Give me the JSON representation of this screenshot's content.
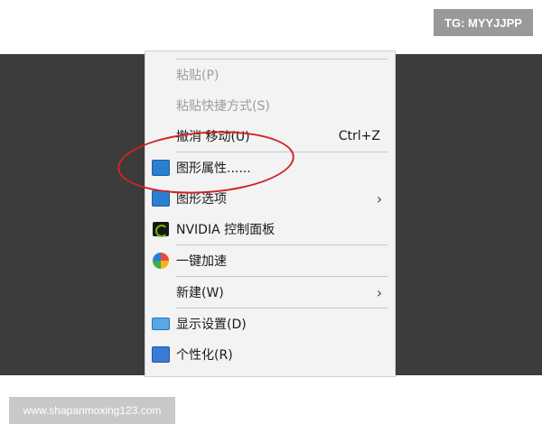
{
  "watermark_top": "TG: MYYJJPP",
  "watermark_bottom": "www.shapanmoxing123.com",
  "menu": {
    "paste": "粘贴(P)",
    "paste_shortcut": "粘贴快捷方式(S)",
    "undo": "撤消 移动(U)",
    "undo_key": "Ctrl+Z",
    "graphics_properties": "图形属性......",
    "graphics_options": "图形选项",
    "nvidia_panel": "NVIDIA 控制面板",
    "one_key_speed": "一键加速",
    "new": "新建(W)",
    "display_settings": "显示设置(D)",
    "personalize": "个性化(R)",
    "submenu_arrow": "›"
  },
  "colors": {
    "desktop": "#3c3c3c",
    "menu_bg": "#f3f3f3",
    "annotation": "#d02424",
    "nvidia_green": "#76b900"
  }
}
